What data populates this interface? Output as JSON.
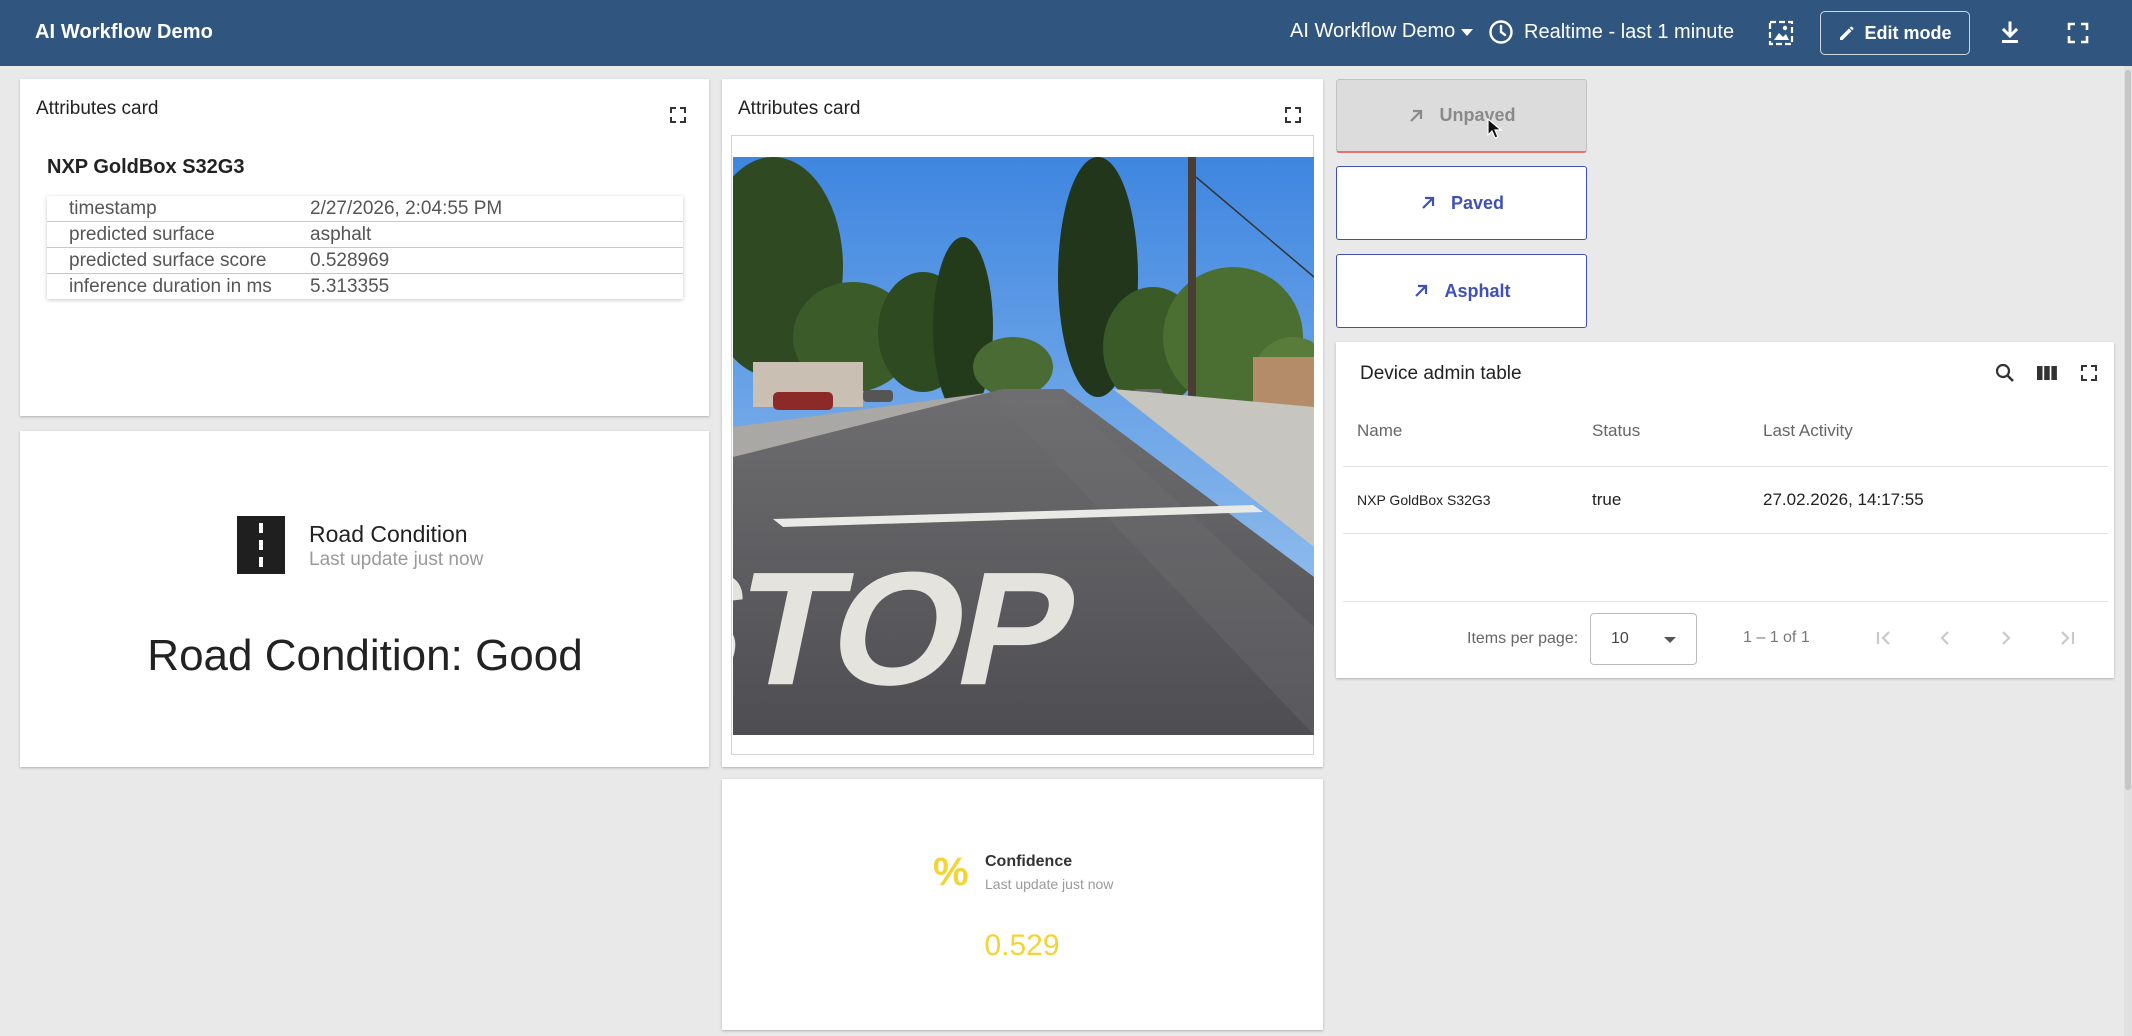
{
  "app": {
    "title": "AI Workflow Demo",
    "dashboard_selector": "AI Workflow Demo",
    "timewindow": "Realtime - last 1 minute",
    "edit_mode_label": "Edit mode"
  },
  "attributes_card_1": {
    "title": "Attributes card",
    "device": "NXP GoldBox S32G3",
    "rows": [
      {
        "key": "timestamp",
        "value": "2/27/2026, 2:04:55 PM"
      },
      {
        "key": "predicted surface",
        "value": "asphalt"
      },
      {
        "key": "predicted surface score",
        "value": "0.528969"
      },
      {
        "key": "inference duration in ms",
        "value": "5.313355"
      }
    ]
  },
  "attributes_card_2": {
    "title": "Attributes card",
    "image_text": "STOP"
  },
  "road_condition": {
    "title": "Road Condition",
    "subtitle": "Last update just now",
    "value": "Road Condition: Good"
  },
  "actions": {
    "unpaved": "Unpaved",
    "paved": "Paved",
    "asphalt": "Asphalt"
  },
  "device_table": {
    "title": "Device admin table",
    "columns": [
      "Name",
      "Status",
      "Last Activity"
    ],
    "rows": [
      {
        "name": "NXP GoldBox S32G3",
        "status": "true",
        "last_activity": "27.02.2026, 14:17:55"
      }
    ],
    "items_per_page_label": "Items per page:",
    "items_per_page": "10",
    "range": "1 – 1 of 1"
  },
  "confidence": {
    "title": "Confidence",
    "subtitle": "Last update just now",
    "value": "0.529"
  },
  "colors": {
    "header": "#305680",
    "accent": "#3f51b5",
    "confidence": "#f4d434"
  }
}
